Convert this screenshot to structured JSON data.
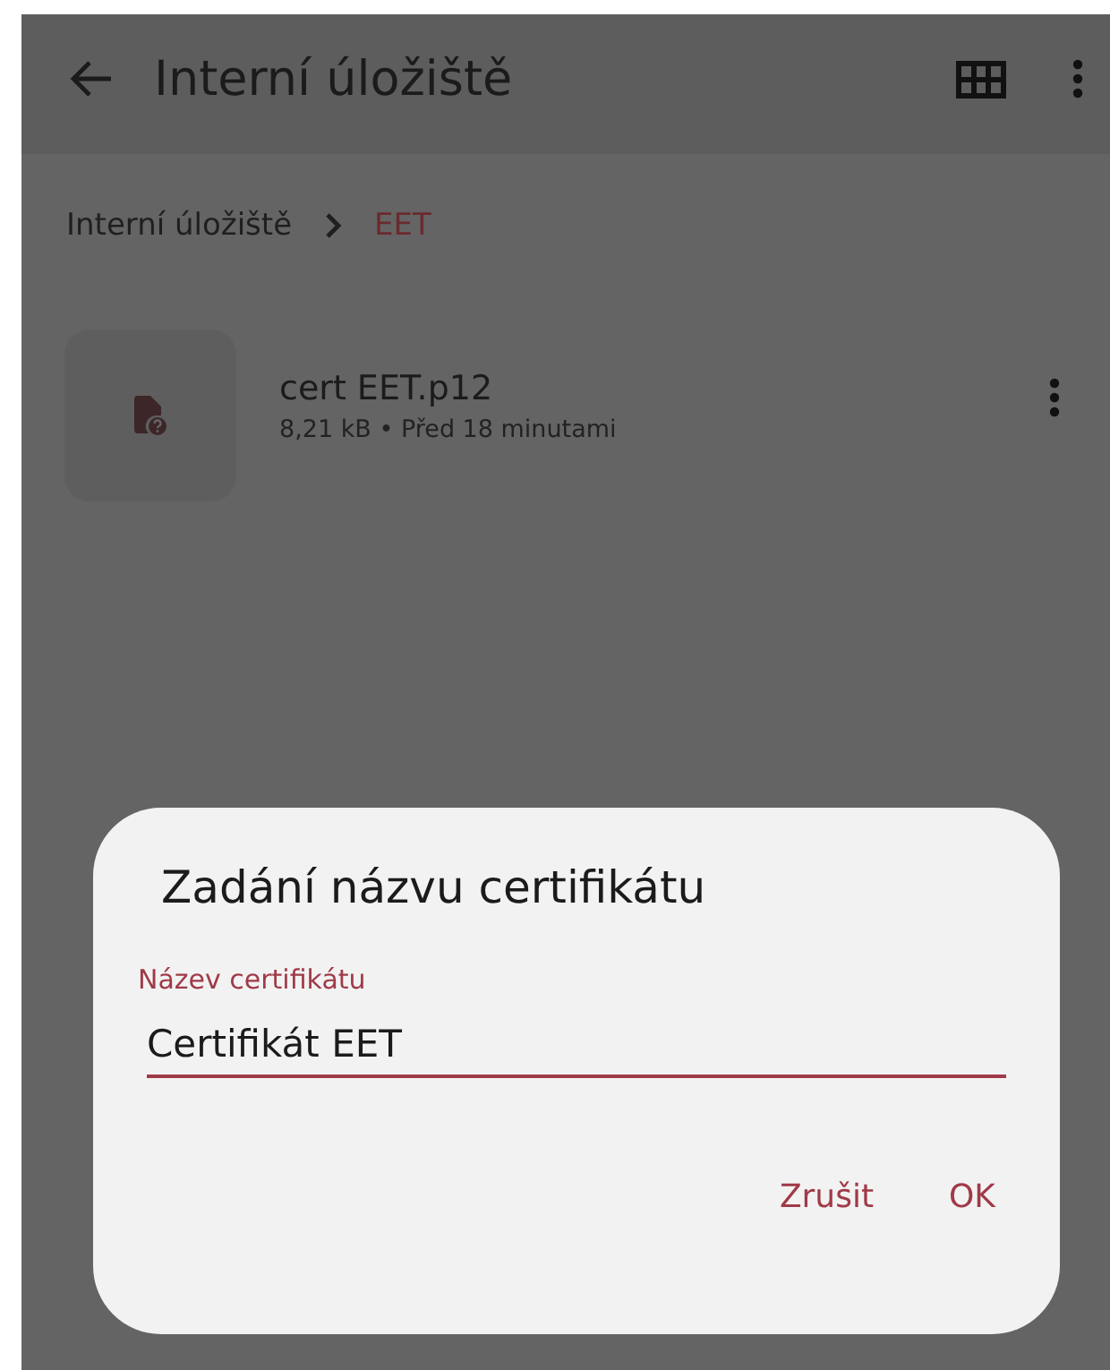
{
  "app_bar": {
    "title": "Interní úložiště"
  },
  "breadcrumb": [
    {
      "label": "Interní úložiště",
      "selected": false
    },
    {
      "label": "EET",
      "selected": true
    }
  ],
  "files": [
    {
      "name": "cert EET.p12",
      "meta": "8,21 kB • Před 18 minutami"
    }
  ],
  "dialog": {
    "title": "Zadání názvu certifikátu",
    "field": {
      "label": "Název certifikátu",
      "value": "Certifikát EET",
      "focused": true
    },
    "buttons": [
      "Zrušit",
      "OK"
    ]
  }
}
